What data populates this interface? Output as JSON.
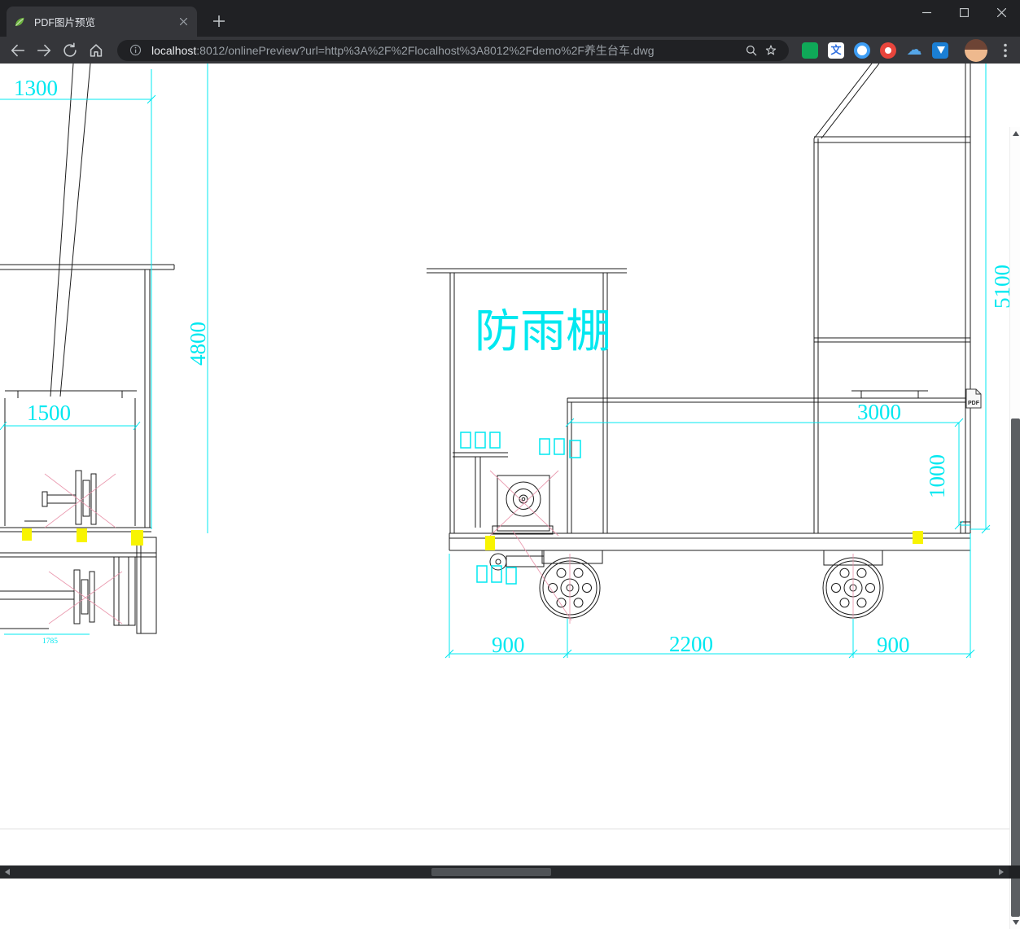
{
  "browser": {
    "tab": {
      "title": "PDF图片预览"
    },
    "address_bar": {
      "url_host": "localhost",
      "url_rest": ":8012/onlinePreview?url=http%3A%2F%2Flocalhost%3A8012%2Fdemo%2F养生台车.dwg"
    },
    "icon_glyphs": {
      "translate": "文",
      "cloud": "☁"
    }
  },
  "drawing": {
    "shelter_label": "防雨棚",
    "pdf_icon_label": "PDF",
    "dimensions": {
      "top_left_width": "1300",
      "left_total_height": "4800",
      "left_inner_width": "1500",
      "left_bottom_width": "1785",
      "bottom_left_span": "900",
      "bottom_center_span": "2200",
      "bottom_right_span": "900",
      "right_platform_width": "3000",
      "right_platform_height": "1000",
      "right_total_height": "5100"
    },
    "colors": {
      "dimension_cyan": "#00e8f0",
      "line_black": "#1c1c1c",
      "highlight_yellow": "#f8f402",
      "centerline_pink": "#e891a8"
    }
  }
}
